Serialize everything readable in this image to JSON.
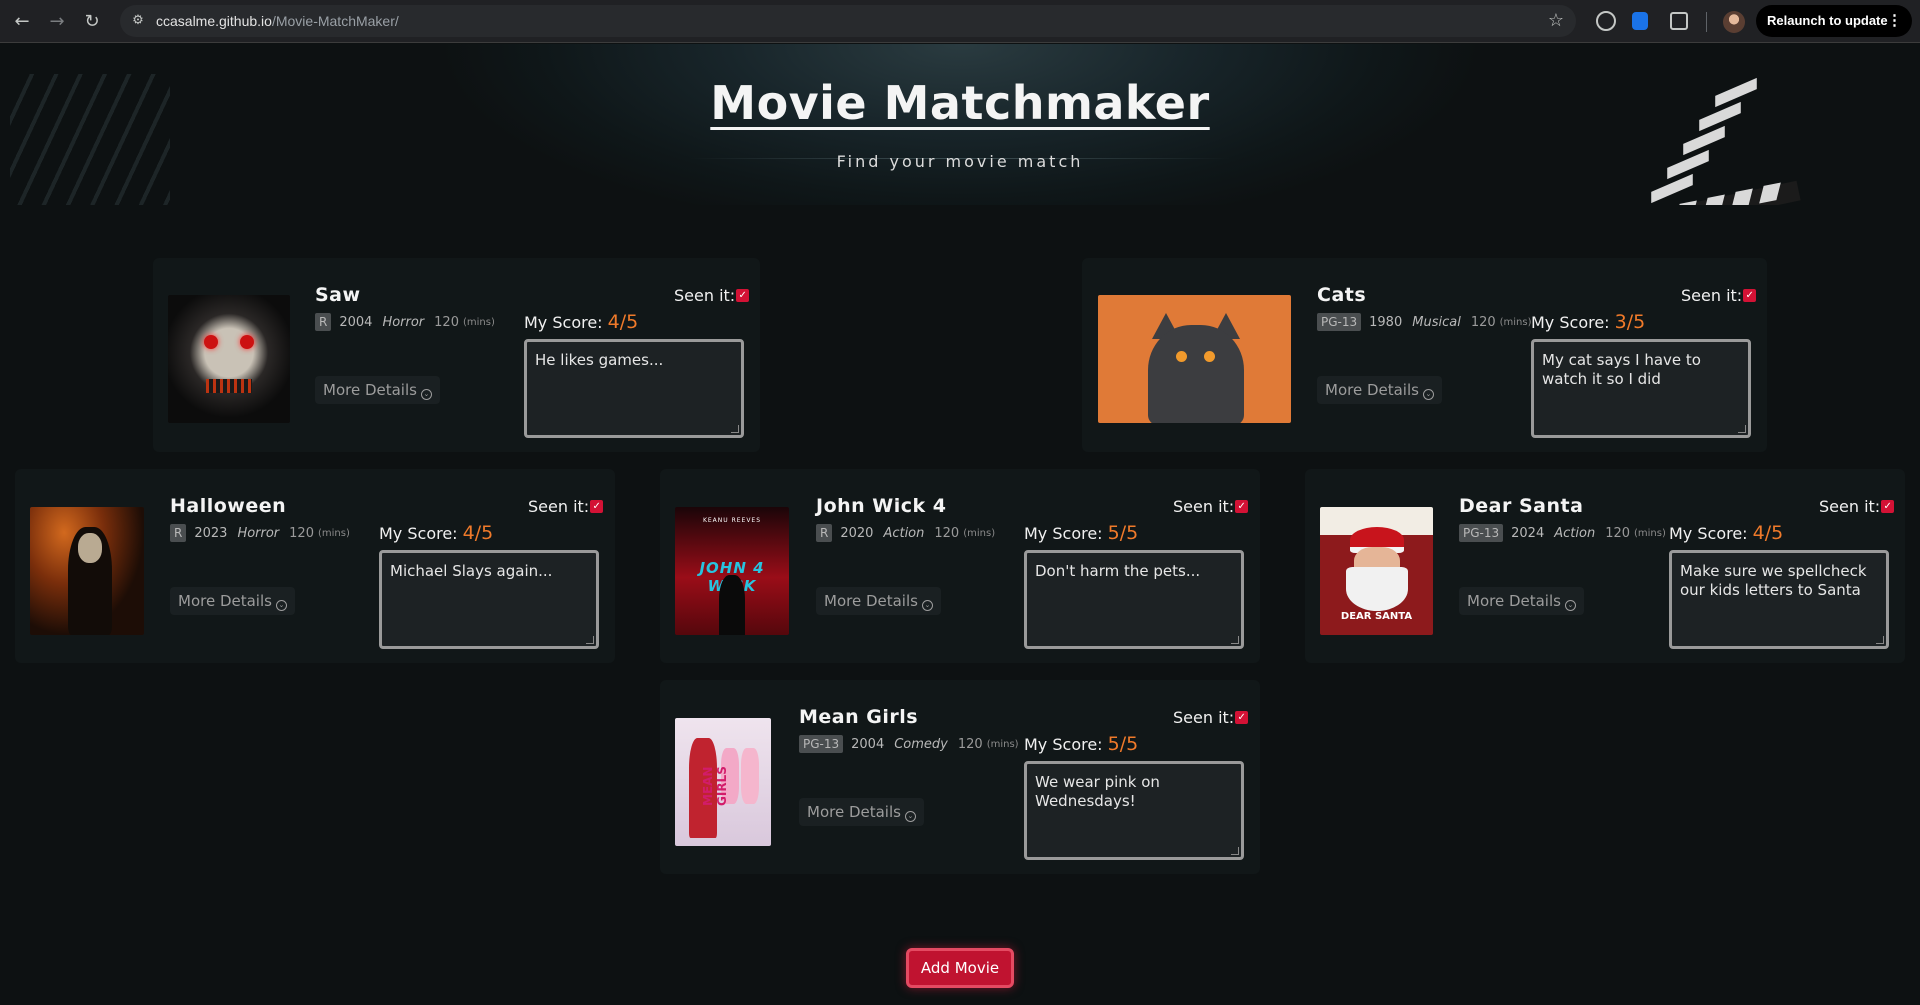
{
  "browser": {
    "url_host": "ccasalme.github.io",
    "url_path": "/Movie-MatchMaker/",
    "relaunch_label": "Relaunch to update"
  },
  "hero": {
    "title": "Movie Matchmaker",
    "subtitle": "Find your movie match"
  },
  "labels": {
    "seen": "Seen it:",
    "score": "My Score: ",
    "details": "More Details",
    "mins": "(mins)"
  },
  "movies": [
    {
      "title": "Saw",
      "rating": "R",
      "year": "2004",
      "genre": "Horror",
      "runtime": "120",
      "score": "4/5",
      "seen": true,
      "notes": "He likes games...",
      "poster_icon": "saw-poster"
    },
    {
      "title": "Cats",
      "rating": "PG-13",
      "year": "1980",
      "genre": "Musical",
      "runtime": "120",
      "score": "3/5",
      "seen": true,
      "notes": "My cat says I have to watch it so I did",
      "poster_icon": "cat-poster"
    },
    {
      "title": "Halloween",
      "rating": "R",
      "year": "2023",
      "genre": "Horror",
      "runtime": "120",
      "score": "4/5",
      "seen": true,
      "notes": "Michael Slays again...",
      "poster_icon": "halloween-poster"
    },
    {
      "title": "John Wick 4",
      "rating": "R",
      "year": "2020",
      "genre": "Action",
      "runtime": "120",
      "score": "5/5",
      "seen": true,
      "notes": "Don't harm the pets...",
      "poster_icon": "john-wick-poster",
      "poster_title": "JOHN 4 WICK",
      "poster_top": "KEANU REEVES"
    },
    {
      "title": "Dear Santa",
      "rating": "PG-13",
      "year": "2024",
      "genre": "Action",
      "runtime": "120",
      "score": "4/5",
      "seen": true,
      "notes": "Make sure we spellcheck our kids letters to Santa",
      "poster_icon": "santa-poster",
      "poster_title": "DEAR SANTA"
    },
    {
      "title": "Mean Girls",
      "rating": "PG-13",
      "year": "2004",
      "genre": "Comedy",
      "runtime": "120",
      "score": "5/5",
      "seen": true,
      "notes": "We wear pink on Wednesdays!",
      "poster_icon": "mean-girls-poster",
      "poster_title": "MEAN GIRLS"
    }
  ],
  "add_button": {
    "label": "Add Movie"
  },
  "colors": {
    "background": "#0d1112",
    "card": "#111718",
    "accent": "#c01330",
    "score": "#f07a2a"
  }
}
